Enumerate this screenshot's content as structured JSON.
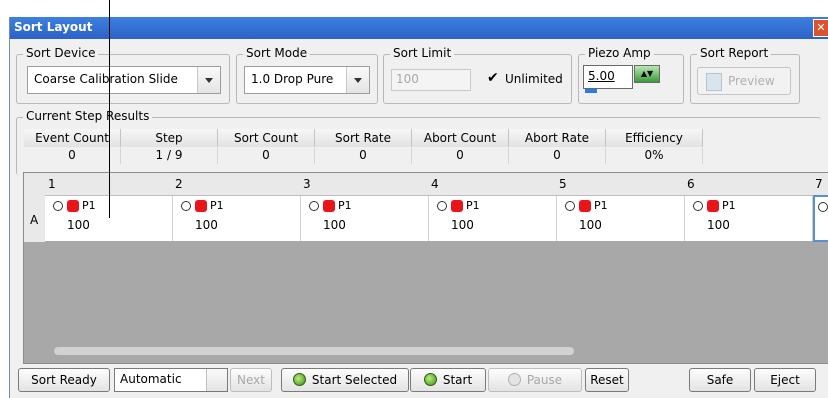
{
  "window": {
    "title": "Sort Layout",
    "close_glyph": "✕"
  },
  "sort_device": {
    "label": "Sort Device",
    "value": "Coarse Calibration Slide"
  },
  "sort_mode": {
    "label": "Sort Mode",
    "value": "1.0 Drop Pure"
  },
  "sort_limit": {
    "label": "Sort Limit",
    "value": "100",
    "unlimited_label": "Unlimited",
    "unlimited_checked": true
  },
  "piezo_amp": {
    "label": "Piezo Amp",
    "value": "5.00"
  },
  "sort_report": {
    "label": "Sort Report",
    "preview_label": "Preview"
  },
  "results": {
    "label": "Current Step Results",
    "headers": [
      "Event Count",
      "Step",
      "Sort Count",
      "Sort Rate",
      "Abort Count",
      "Abort Rate",
      "Efficiency"
    ],
    "values": [
      "0",
      "1 / 9",
      "0",
      "0",
      "0",
      "0",
      "0%"
    ]
  },
  "plate": {
    "columns": [
      "1",
      "2",
      "3",
      "4",
      "5",
      "6",
      "7"
    ],
    "rows": [
      "A"
    ],
    "wells": [
      {
        "name": "P1",
        "count": "100"
      },
      {
        "name": "P1",
        "count": "100"
      },
      {
        "name": "P1",
        "count": "100"
      },
      {
        "name": "P1",
        "count": "100"
      },
      {
        "name": "P1",
        "count": "100"
      },
      {
        "name": "P1",
        "count": "100"
      }
    ]
  },
  "toolbar": {
    "sort_ready": "Sort Ready",
    "mode": "Automatic",
    "next": "Next",
    "start_selected": "Start Selected",
    "start": "Start",
    "pause": "Pause",
    "reset": "Reset",
    "safe": "Safe",
    "eject": "Eject"
  },
  "colors": {
    "title_bar": "#2c62c6",
    "well_marker": "#e8161b",
    "led_green": "#3c8a1a"
  }
}
